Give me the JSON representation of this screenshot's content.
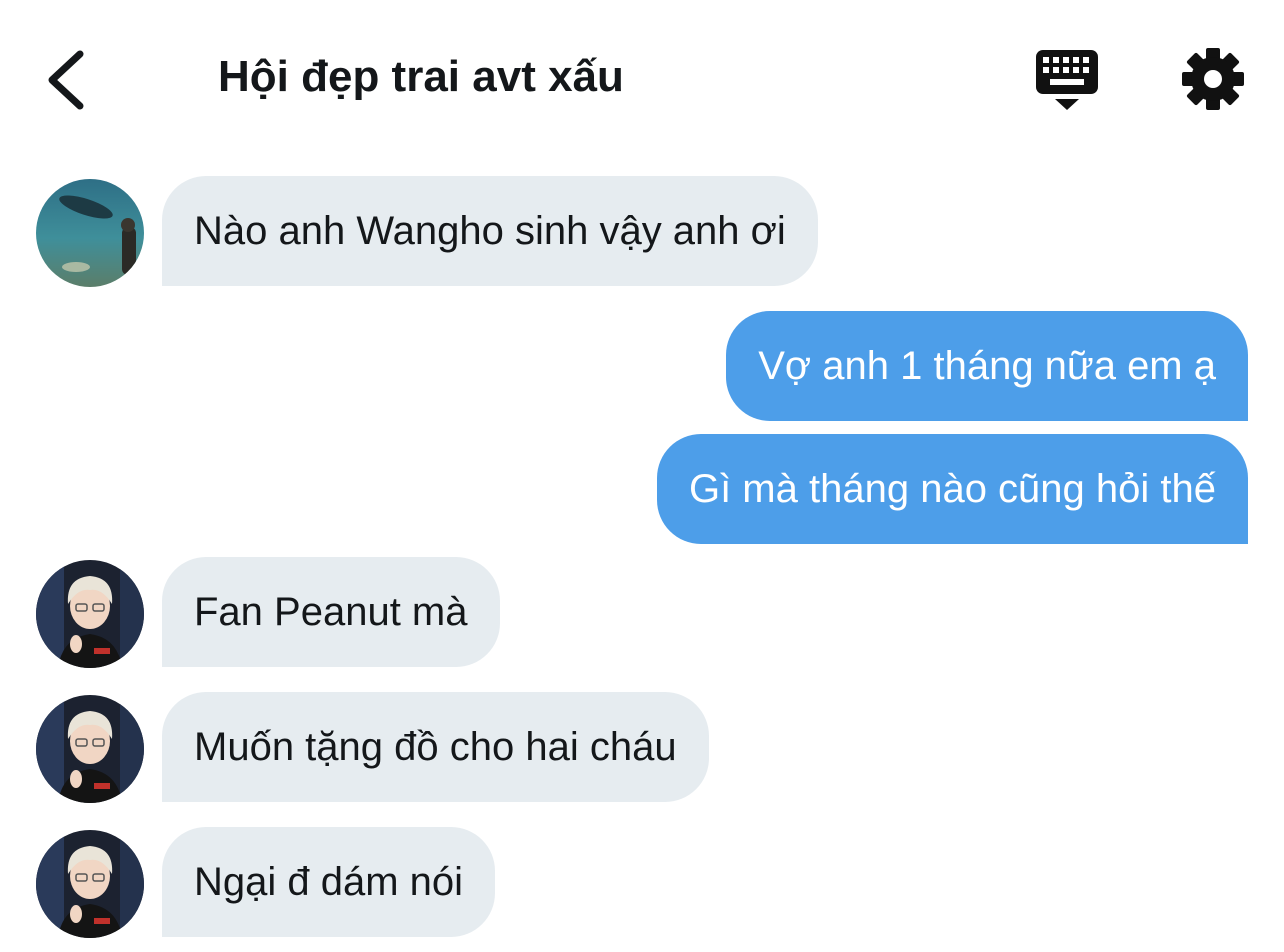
{
  "header": {
    "title": "Hội đẹp trai avt xấu",
    "back_icon": "chevron-left-icon",
    "keyboard_icon": "keyboard-icon",
    "settings_icon": "gear-icon"
  },
  "colors": {
    "incoming_bubble": "#e6ecf0",
    "outgoing_bubble": "#4d9ee9",
    "text": "#14171a"
  },
  "messages": [
    {
      "direction": "incoming",
      "avatar": "aquarium-avatar",
      "text": "Nào anh Wangho sinh vậy anh ơi"
    },
    {
      "direction": "outgoing",
      "text": "Vợ anh 1 tháng nữa em ạ"
    },
    {
      "direction": "outgoing",
      "text": "Gì mà tháng nào cũng hỏi thế"
    },
    {
      "direction": "incoming",
      "avatar": "player-avatar",
      "text": "Fan Peanut mà"
    },
    {
      "direction": "incoming",
      "avatar": "player-avatar",
      "text": "Muốn tặng đồ cho hai cháu"
    },
    {
      "direction": "incoming",
      "avatar": "player-avatar",
      "text": "Ngại đ dám nói"
    }
  ]
}
